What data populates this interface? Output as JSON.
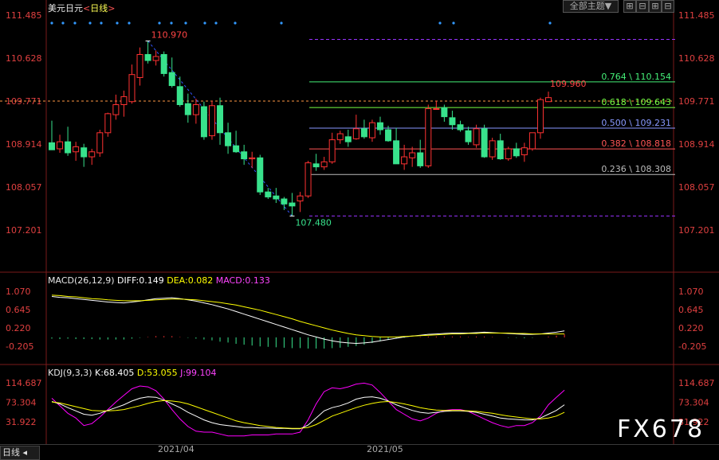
{
  "header": {
    "symbol": "美元日元",
    "period_prefix": "<",
    "period": "日线",
    "period_suffix": ">"
  },
  "toolbar": {
    "theme_label": "全部主题▼",
    "btn1": "⊞",
    "btn2": "⊟",
    "btn3": "⊞",
    "btn4": "⊟"
  },
  "macd_header": {
    "name": "MACD(26,12,9)",
    "diff": "DIFF:0.149",
    "dea": "DEA:0.082",
    "macd": "MACD:0.133"
  },
  "kdj_header": {
    "name": "KDJ(9,3,3)",
    "k": "K:68.405",
    "d": "D:53.055",
    "j": "J:99.104"
  },
  "bottom": {
    "tab": "日线",
    "dates": [
      "2021/04",
      "2021/05"
    ]
  },
  "watermark": "FX678",
  "colors": {
    "up": "#ff3232",
    "down": "#38e28c",
    "diff": "#ffffff",
    "dea": "#ffff00",
    "k": "#ffffff",
    "d": "#ffff00",
    "j": "#ff00ff"
  },
  "chart_data": [
    {
      "type": "candlestick",
      "title": "美元日元 日线",
      "y_ticks": [
        "111.485",
        "110.628",
        "109.771",
        "108.914",
        "108.057",
        "107.201"
      ],
      "ylim": [
        106.5,
        111.6
      ],
      "high_label": "110.970",
      "low_label": "107.480",
      "last_high_label": "109.960",
      "fib_levels": [
        {
          "label": "0.764 \\ 110.154",
          "value": 110.154,
          "color": "#44ee77"
        },
        {
          "label": "0.618 \\ 109.643",
          "value": 109.643,
          "color": "#77ff44"
        },
        {
          "label": "0.500 \\ 109.231",
          "value": 109.231,
          "color": "#8899ff"
        },
        {
          "label": "0.382 \\ 108.818",
          "value": 108.818,
          "color": "#ff5555"
        },
        {
          "label": "0.236 \\ 108.308",
          "value": 108.308,
          "color": "#bbbbbb"
        }
      ],
      "fib_bounds": [
        110.97,
        107.48
      ],
      "last_price": 109.771,
      "candles": [
        [
          108.94,
          109.38,
          108.8,
          108.8
        ],
        [
          108.82,
          109.1,
          108.74,
          108.96
        ],
        [
          108.96,
          109.26,
          108.68,
          108.74
        ],
        [
          108.76,
          108.96,
          108.58,
          108.86
        ],
        [
          108.84,
          108.92,
          108.46,
          108.66
        ],
        [
          108.66,
          108.82,
          108.5,
          108.76
        ],
        [
          108.74,
          109.2,
          108.66,
          109.14
        ],
        [
          109.14,
          109.54,
          109.06,
          109.52
        ],
        [
          109.5,
          109.9,
          109.4,
          109.7
        ],
        [
          109.7,
          109.98,
          109.46,
          109.86
        ],
        [
          109.76,
          110.5,
          109.72,
          110.3
        ],
        [
          110.24,
          110.84,
          110.08,
          110.7
        ],
        [
          110.7,
          110.97,
          110.52,
          110.58
        ],
        [
          110.58,
          110.78,
          110.48,
          110.66
        ],
        [
          110.7,
          110.76,
          110.26,
          110.32
        ],
        [
          110.34,
          110.64,
          110.04,
          110.08
        ],
        [
          110.06,
          110.26,
          109.66,
          109.7
        ],
        [
          109.72,
          109.92,
          109.34,
          109.5
        ],
        [
          109.5,
          109.82,
          109.32,
          109.7
        ],
        [
          109.66,
          109.76,
          109.0,
          109.06
        ],
        [
          109.08,
          109.78,
          109.0,
          109.68
        ],
        [
          109.68,
          109.84,
          108.9,
          109.14
        ],
        [
          109.14,
          109.34,
          108.72,
          108.88
        ],
        [
          108.88,
          109.18,
          108.74,
          108.76
        ],
        [
          108.76,
          108.9,
          108.5,
          108.62
        ],
        [
          108.62,
          108.76,
          108.44,
          108.64
        ],
        [
          108.64,
          108.7,
          107.9,
          107.96
        ],
        [
          107.96,
          108.04,
          107.82,
          107.86
        ],
        [
          107.88,
          108.04,
          107.74,
          107.82
        ],
        [
          107.82,
          107.86,
          107.6,
          107.72
        ],
        [
          107.74,
          107.94,
          107.48,
          107.68
        ],
        [
          107.78,
          107.96,
          107.56,
          107.88
        ],
        [
          107.88,
          108.58,
          107.84,
          108.54
        ],
        [
          108.52,
          108.72,
          108.38,
          108.46
        ],
        [
          108.46,
          108.66,
          108.4,
          108.56
        ],
        [
          108.56,
          109.14,
          108.52,
          109.0
        ],
        [
          109.0,
          109.18,
          108.92,
          109.12
        ],
        [
          109.06,
          109.2,
          108.86,
          108.96
        ],
        [
          109.02,
          109.5,
          109.0,
          109.22
        ],
        [
          109.22,
          109.4,
          109.02,
          109.06
        ],
        [
          109.04,
          109.4,
          108.96,
          109.34
        ],
        [
          109.34,
          109.46,
          109.1,
          109.2
        ],
        [
          109.2,
          109.28,
          108.96,
          108.98
        ],
        [
          108.98,
          109.24,
          108.52,
          108.52
        ],
        [
          108.52,
          108.9,
          108.4,
          108.66
        ],
        [
          108.64,
          108.86,
          108.46,
          108.74
        ],
        [
          108.74,
          109.0,
          108.44,
          108.48
        ],
        [
          108.48,
          109.7,
          108.44,
          109.62
        ],
        [
          109.62,
          109.78,
          109.6,
          109.62
        ],
        [
          109.64,
          109.7,
          109.36,
          109.46
        ],
        [
          109.44,
          109.58,
          109.2,
          109.3
        ],
        [
          109.3,
          109.38,
          109.16,
          109.2
        ],
        [
          109.18,
          109.26,
          108.9,
          108.96
        ],
        [
          108.9,
          109.3,
          108.84,
          109.22
        ],
        [
          109.22,
          109.3,
          108.64,
          108.66
        ],
        [
          108.66,
          109.04,
          108.6,
          108.98
        ],
        [
          108.98,
          109.12,
          108.6,
          108.62
        ],
        [
          108.62,
          108.86,
          108.58,
          108.82
        ],
        [
          108.82,
          108.94,
          108.64,
          108.68
        ],
        [
          108.7,
          108.94,
          108.56,
          108.84
        ],
        [
          108.82,
          109.14,
          108.78,
          109.14
        ],
        [
          109.14,
          109.84,
          109.02,
          109.8
        ],
        [
          109.76,
          109.96,
          109.76,
          109.84
        ]
      ]
    },
    {
      "type": "macd",
      "y_ticks": [
        "1.070",
        "0.645",
        "0.220",
        "-0.205"
      ],
      "ylim": [
        -0.5,
        1.2
      ],
      "diff": [
        0.95,
        0.93,
        0.92,
        0.9,
        0.88,
        0.86,
        0.84,
        0.82,
        0.81,
        0.8,
        0.82,
        0.84,
        0.87,
        0.9,
        0.91,
        0.92,
        0.9,
        0.87,
        0.84,
        0.8,
        0.76,
        0.71,
        0.66,
        0.6,
        0.54,
        0.48,
        0.42,
        0.36,
        0.3,
        0.24,
        0.18,
        0.12,
        0.06,
        0.01,
        -0.04,
        -0.08,
        -0.11,
        -0.13,
        -0.14,
        -0.13,
        -0.11,
        -0.08,
        -0.05,
        -0.02,
        0.01,
        0.03,
        0.05,
        0.07,
        0.08,
        0.09,
        0.1,
        0.1,
        0.1,
        0.11,
        0.12,
        0.11,
        0.1,
        0.09,
        0.08,
        0.07,
        0.07,
        0.08,
        0.1,
        0.12,
        0.15
      ],
      "dea": [
        0.98,
        0.97,
        0.95,
        0.94,
        0.92,
        0.9,
        0.89,
        0.87,
        0.86,
        0.85,
        0.85,
        0.85,
        0.86,
        0.87,
        0.88,
        0.89,
        0.89,
        0.88,
        0.87,
        0.85,
        0.83,
        0.81,
        0.78,
        0.75,
        0.71,
        0.67,
        0.63,
        0.58,
        0.53,
        0.48,
        0.43,
        0.37,
        0.32,
        0.27,
        0.22,
        0.17,
        0.13,
        0.09,
        0.06,
        0.04,
        0.02,
        0.01,
        0.01,
        0.01,
        0.02,
        0.03,
        0.04,
        0.05,
        0.06,
        0.07,
        0.08,
        0.08,
        0.09,
        0.09,
        0.1,
        0.1,
        0.1,
        0.1,
        0.09,
        0.09,
        0.08,
        0.08,
        0.08,
        0.08,
        0.08
      ],
      "hist": [
        -0.03,
        -0.04,
        -0.03,
        -0.04,
        -0.04,
        -0.04,
        -0.05,
        -0.05,
        -0.05,
        -0.05,
        -0.03,
        -0.01,
        0.01,
        0.03,
        0.03,
        0.03,
        0.01,
        -0.01,
        -0.03,
        -0.05,
        -0.07,
        -0.1,
        -0.12,
        -0.15,
        -0.17,
        -0.19,
        -0.21,
        -0.22,
        -0.23,
        -0.24,
        -0.25,
        -0.25,
        -0.26,
        -0.26,
        -0.26,
        -0.25,
        -0.24,
        -0.22,
        -0.2,
        -0.17,
        -0.13,
        -0.09,
        -0.06,
        -0.03,
        -0.01,
        0.0,
        0.01,
        0.02,
        0.02,
        0.02,
        0.02,
        0.02,
        0.01,
        0.02,
        0.02,
        0.01,
        0.0,
        -0.01,
        -0.01,
        -0.02,
        -0.01,
        0.0,
        0.02,
        0.04,
        0.07
      ]
    },
    {
      "type": "kdj",
      "y_ticks": [
        "114.687",
        "73.304",
        "31.922"
      ],
      "ylim": [
        0,
        140
      ],
      "k": [
        75,
        70,
        62,
        55,
        48,
        46,
        50,
        56,
        62,
        68,
        76,
        82,
        85,
        84,
        78,
        70,
        62,
        52,
        44,
        36,
        30,
        26,
        24,
        22,
        20,
        20,
        19,
        19,
        18,
        18,
        17,
        17,
        25,
        40,
        55,
        62,
        66,
        72,
        80,
        84,
        85,
        82,
        76,
        68,
        62,
        56,
        52,
        50,
        52,
        54,
        55,
        55,
        54,
        52,
        48,
        44,
        40,
        38,
        37,
        36,
        36,
        40,
        48,
        56,
        68
      ],
      "d": [
        74,
        72,
        68,
        64,
        60,
        56,
        55,
        55,
        56,
        58,
        62,
        66,
        71,
        75,
        77,
        76,
        74,
        70,
        64,
        58,
        52,
        46,
        40,
        34,
        30,
        27,
        24,
        22,
        20,
        19,
        18,
        18,
        20,
        26,
        35,
        44,
        50,
        56,
        62,
        67,
        71,
        74,
        75,
        73,
        70,
        66,
        62,
        59,
        57,
        56,
        56,
        56,
        55,
        54,
        52,
        50,
        47,
        44,
        42,
        40,
        38,
        38,
        40,
        44,
        52
      ],
      "j": [
        82,
        66,
        50,
        40,
        24,
        28,
        42,
        58,
        74,
        88,
        102,
        108,
        106,
        98,
        80,
        58,
        38,
        22,
        12,
        10,
        10,
        6,
        2,
        2,
        2,
        4,
        4,
        4,
        6,
        6,
        6,
        10,
        36,
        70,
        96,
        104,
        102,
        106,
        112,
        114,
        110,
        94,
        76,
        58,
        48,
        38,
        34,
        40,
        50,
        56,
        58,
        58,
        54,
        46,
        38,
        30,
        24,
        20,
        24,
        24,
        30,
        44,
        68,
        84,
        99
      ]
    }
  ]
}
